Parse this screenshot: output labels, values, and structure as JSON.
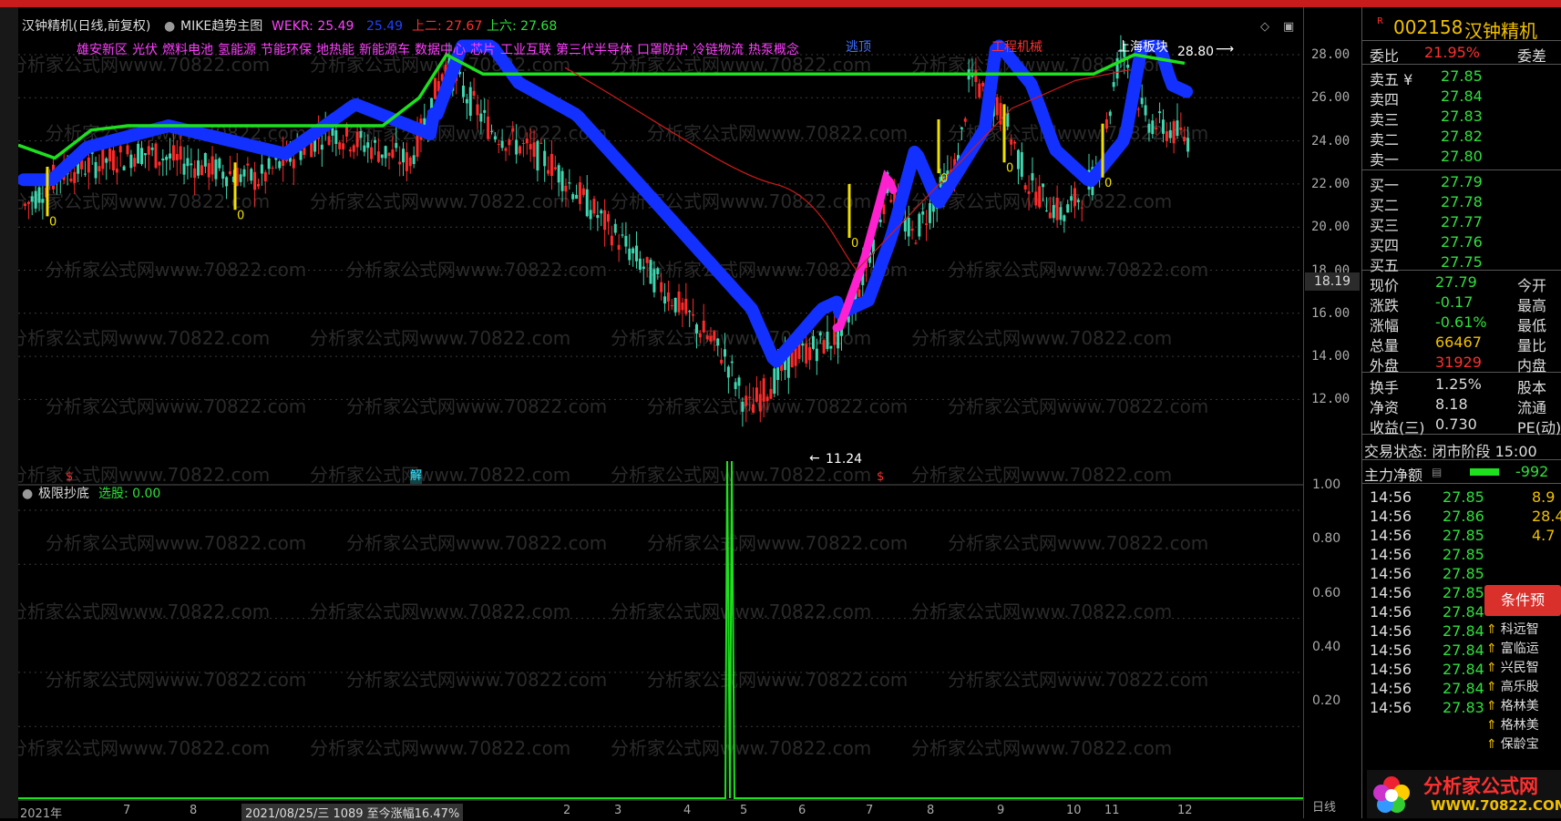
{
  "header": {
    "stock_name": "汉钟精机(日线,前复权)",
    "indicator_name": "MIKE趋势主图",
    "wekr_label": "WEKR: 25.49",
    "wekr2_label": "25.49",
    "up2_label": "上二: 27.67",
    "up6_label": "上六: 27.68",
    "concepts": [
      "雄安新区",
      "光伏",
      "燃料电池",
      "氢能源",
      "节能环保",
      "地热能",
      "新能源车",
      "数据中心",
      "芯片",
      "工业互联",
      "第三代半导体",
      "口罩防护",
      "冷链物流",
      "热泵概念"
    ],
    "escape_top": "逃顶",
    "sector_tag": "工程机械",
    "shanghai_tag": "上海板块"
  },
  "chart_annotations": {
    "high_price": "28.80",
    "low_price": "11.24",
    "current_price_tag": "18.19",
    "marker_jie": "解",
    "marker_dollar": "$",
    "zero_label": "0"
  },
  "sub_indicator": {
    "name": "极限抄底",
    "select_label": "选股: 0.00",
    "y_ticks": [
      "1.00",
      "0.80",
      "0.60",
      "0.40",
      "0.20"
    ]
  },
  "x_axis": {
    "labels": [
      "2021年",
      "7",
      "8",
      "2021/08/25/三 1089 至今涨幅16.47%",
      "2",
      "3",
      "4",
      "5",
      "6",
      "7",
      "8",
      "9",
      "10",
      "11",
      "12"
    ],
    "period": "日线"
  },
  "price_axis": [
    "28.00",
    "26.00",
    "24.00",
    "22.00",
    "20.00",
    "18.00",
    "16.00",
    "14.00",
    "12.00"
  ],
  "side_panel": {
    "code": "002158",
    "name": "汉钟精机",
    "weibi_label": "委比",
    "weibi_value": "21.95%",
    "weicha_label": "委差",
    "asks": [
      {
        "label": "卖五 ¥",
        "price": "27.85"
      },
      {
        "label": "卖四",
        "price": "27.84"
      },
      {
        "label": "卖三",
        "price": "27.83"
      },
      {
        "label": "卖二",
        "price": "27.82"
      },
      {
        "label": "卖一",
        "price": "27.80"
      }
    ],
    "bids": [
      {
        "label": "买一",
        "price": "27.79"
      },
      {
        "label": "买二",
        "price": "27.78"
      },
      {
        "label": "买三",
        "price": "27.77"
      },
      {
        "label": "买四",
        "price": "27.76"
      },
      {
        "label": "买五",
        "price": "27.75"
      }
    ],
    "stats": [
      {
        "label": "现价",
        "value": "27.79",
        "label2": "今开",
        "color": "#2ee03c"
      },
      {
        "label": "涨跌",
        "value": "-0.17",
        "label2": "最高",
        "color": "#2ee03c"
      },
      {
        "label": "涨幅",
        "value": "-0.61%",
        "label2": "最低",
        "color": "#2ee03c"
      },
      {
        "label": "总量",
        "value": "66467",
        "label2": "量比",
        "color": "#f0c000"
      },
      {
        "label": "外盘",
        "value": "31929",
        "label2": "内盘",
        "color": "#ff3030"
      }
    ],
    "stats2": [
      {
        "label": "换手",
        "value": "1.25%",
        "label2": "股本"
      },
      {
        "label": "净资",
        "value": "8.18",
        "label2": "流通"
      },
      {
        "label": "收益(三)",
        "value": "0.730",
        "label2": "PE(动)"
      }
    ],
    "trade_status": "交易状态: 闭市阶段 15:00",
    "main_net_label": "主力净额",
    "main_net_value": "-992",
    "ticks": [
      {
        "time": "14:56",
        "price": "27.85",
        "vol": "8.9"
      },
      {
        "time": "14:56",
        "price": "27.86",
        "vol": "28.4"
      },
      {
        "time": "14:56",
        "price": "27.85",
        "vol": "4.7"
      },
      {
        "time": "14:56",
        "price": "27.85",
        "vol": ""
      },
      {
        "time": "14:56",
        "price": "27.85",
        "vol": ""
      },
      {
        "time": "14:56",
        "price": "27.85",
        "vol": ""
      },
      {
        "time": "14:56",
        "price": "27.84",
        "vol": ""
      },
      {
        "time": "14:56",
        "price": "27.84",
        "vol": ""
      },
      {
        "time": "14:56",
        "price": "27.84",
        "vol": ""
      },
      {
        "time": "14:56",
        "price": "27.84",
        "vol": ""
      },
      {
        "time": "14:56",
        "price": "27.84",
        "vol": ""
      },
      {
        "time": "14:56",
        "price": "27.83",
        "vol": ""
      }
    ],
    "cond_button": "条件预",
    "cond_items": [
      "科远智",
      "富临运",
      "兴民智",
      "高乐股",
      "格林美",
      "格林美",
      "保龄宝"
    ]
  },
  "watermark": "分析家公式网www.70822.com",
  "brand": {
    "title": "分析家公式网",
    "url": "WWW.70822.COM"
  }
}
